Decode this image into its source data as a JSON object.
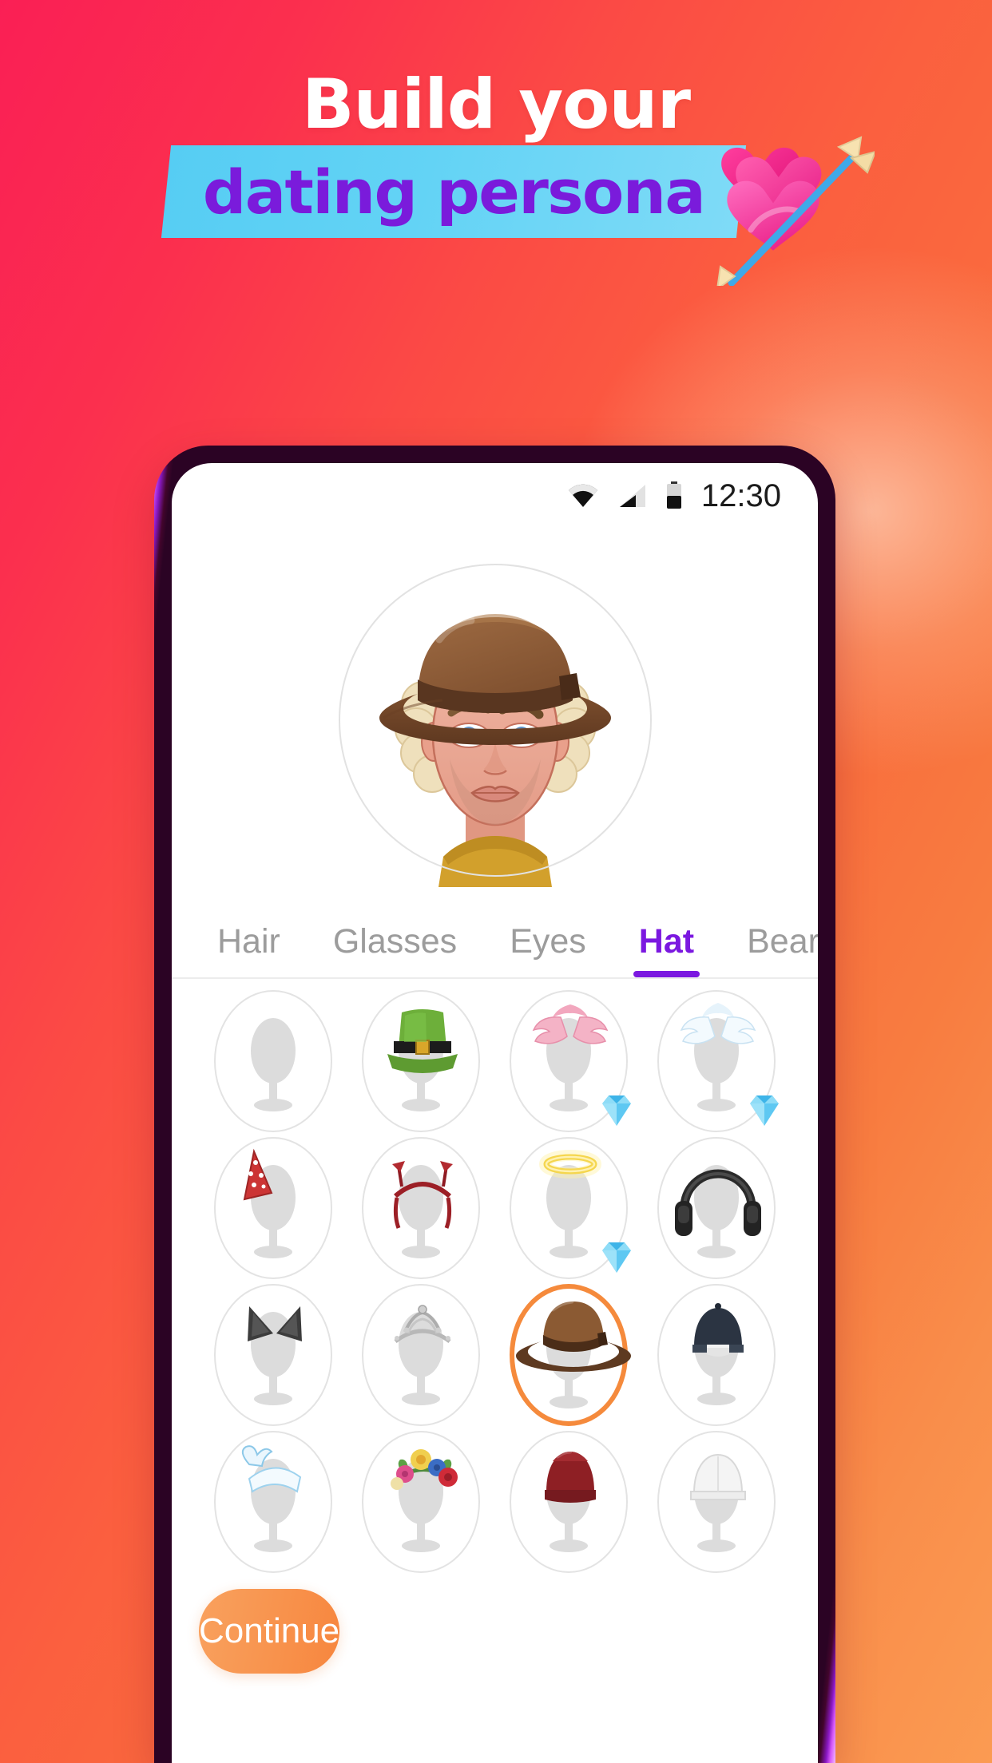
{
  "header": {
    "headline": "Build your",
    "banner_text": "dating persona",
    "banner_color": "#56CDF3",
    "banner_text_color": "#7A1BDB",
    "headline_color": "#FFFFFF",
    "decor_icon": "hearts-with-arrow-icon"
  },
  "background": {
    "gradient_start": "#FA1F55",
    "gradient_end": "#FB9B52"
  },
  "phone": {
    "bezel_color": "#8A18C4",
    "statusbar": {
      "time": "12:30",
      "icons": [
        "wifi-icon",
        "cellular-signal-icon",
        "battery-icon"
      ]
    }
  },
  "avatar": {
    "name": "avatar-preview",
    "description": "male avatar with brown fedora, blond curly hair, blue eyes, stubble, mustard shirt",
    "hat": "brown-fedora",
    "hair": "blond-curly",
    "eye_color": "#4A7EBB",
    "skin": "#E9A48F",
    "shirt_color": "#D9A02C"
  },
  "tabs": {
    "items": [
      {
        "label": "Hair",
        "active": false
      },
      {
        "label": "Glasses",
        "active": false
      },
      {
        "label": "Eyes",
        "active": false
      },
      {
        "label": "Hat",
        "active": true
      },
      {
        "label": "Beard",
        "active": false
      }
    ],
    "active_color": "#7B18E0",
    "inactive_color": "#9C9C9C"
  },
  "grid": {
    "selected_index": 10,
    "selection_color": "#F58A3C",
    "premium_badge": "diamond-icon",
    "items": [
      {
        "name": "none",
        "label": "No hat",
        "premium": false,
        "selected": false
      },
      {
        "name": "leprechaun-hat",
        "label": "Green leprechaun hat",
        "premium": false,
        "selected": false
      },
      {
        "name": "pink-wings",
        "label": "Pink angel wings",
        "premium": true,
        "selected": false
      },
      {
        "name": "white-wings",
        "label": "White angel wings",
        "premium": true,
        "selected": false
      },
      {
        "name": "party-hat",
        "label": "Party hat",
        "premium": false,
        "selected": false
      },
      {
        "name": "devil-horns",
        "label": "Devil horns headband",
        "premium": false,
        "selected": false
      },
      {
        "name": "halo",
        "label": "Angel halo",
        "premium": true,
        "selected": false
      },
      {
        "name": "headphones",
        "label": "Headphones",
        "premium": false,
        "selected": false
      },
      {
        "name": "cat-ears",
        "label": "Cat ears",
        "premium": false,
        "selected": false
      },
      {
        "name": "tiara",
        "label": "Tiara",
        "premium": false,
        "selected": false
      },
      {
        "name": "fedora",
        "label": "Brown fedora",
        "premium": false,
        "selected": true
      },
      {
        "name": "backwards-cap",
        "label": "Backwards cap",
        "premium": false,
        "selected": false
      },
      {
        "name": "blue-bandana",
        "label": "Blue bow bandana",
        "premium": false,
        "selected": false
      },
      {
        "name": "flower-crown",
        "label": "Flower crown",
        "premium": false,
        "selected": false
      },
      {
        "name": "red-beanie",
        "label": "Dark red beanie",
        "premium": false,
        "selected": false
      },
      {
        "name": "white-cap",
        "label": "White cap",
        "premium": false,
        "selected": false
      }
    ]
  },
  "footer": {
    "continue_label": "Continue",
    "continue_color": "#F8913F"
  }
}
